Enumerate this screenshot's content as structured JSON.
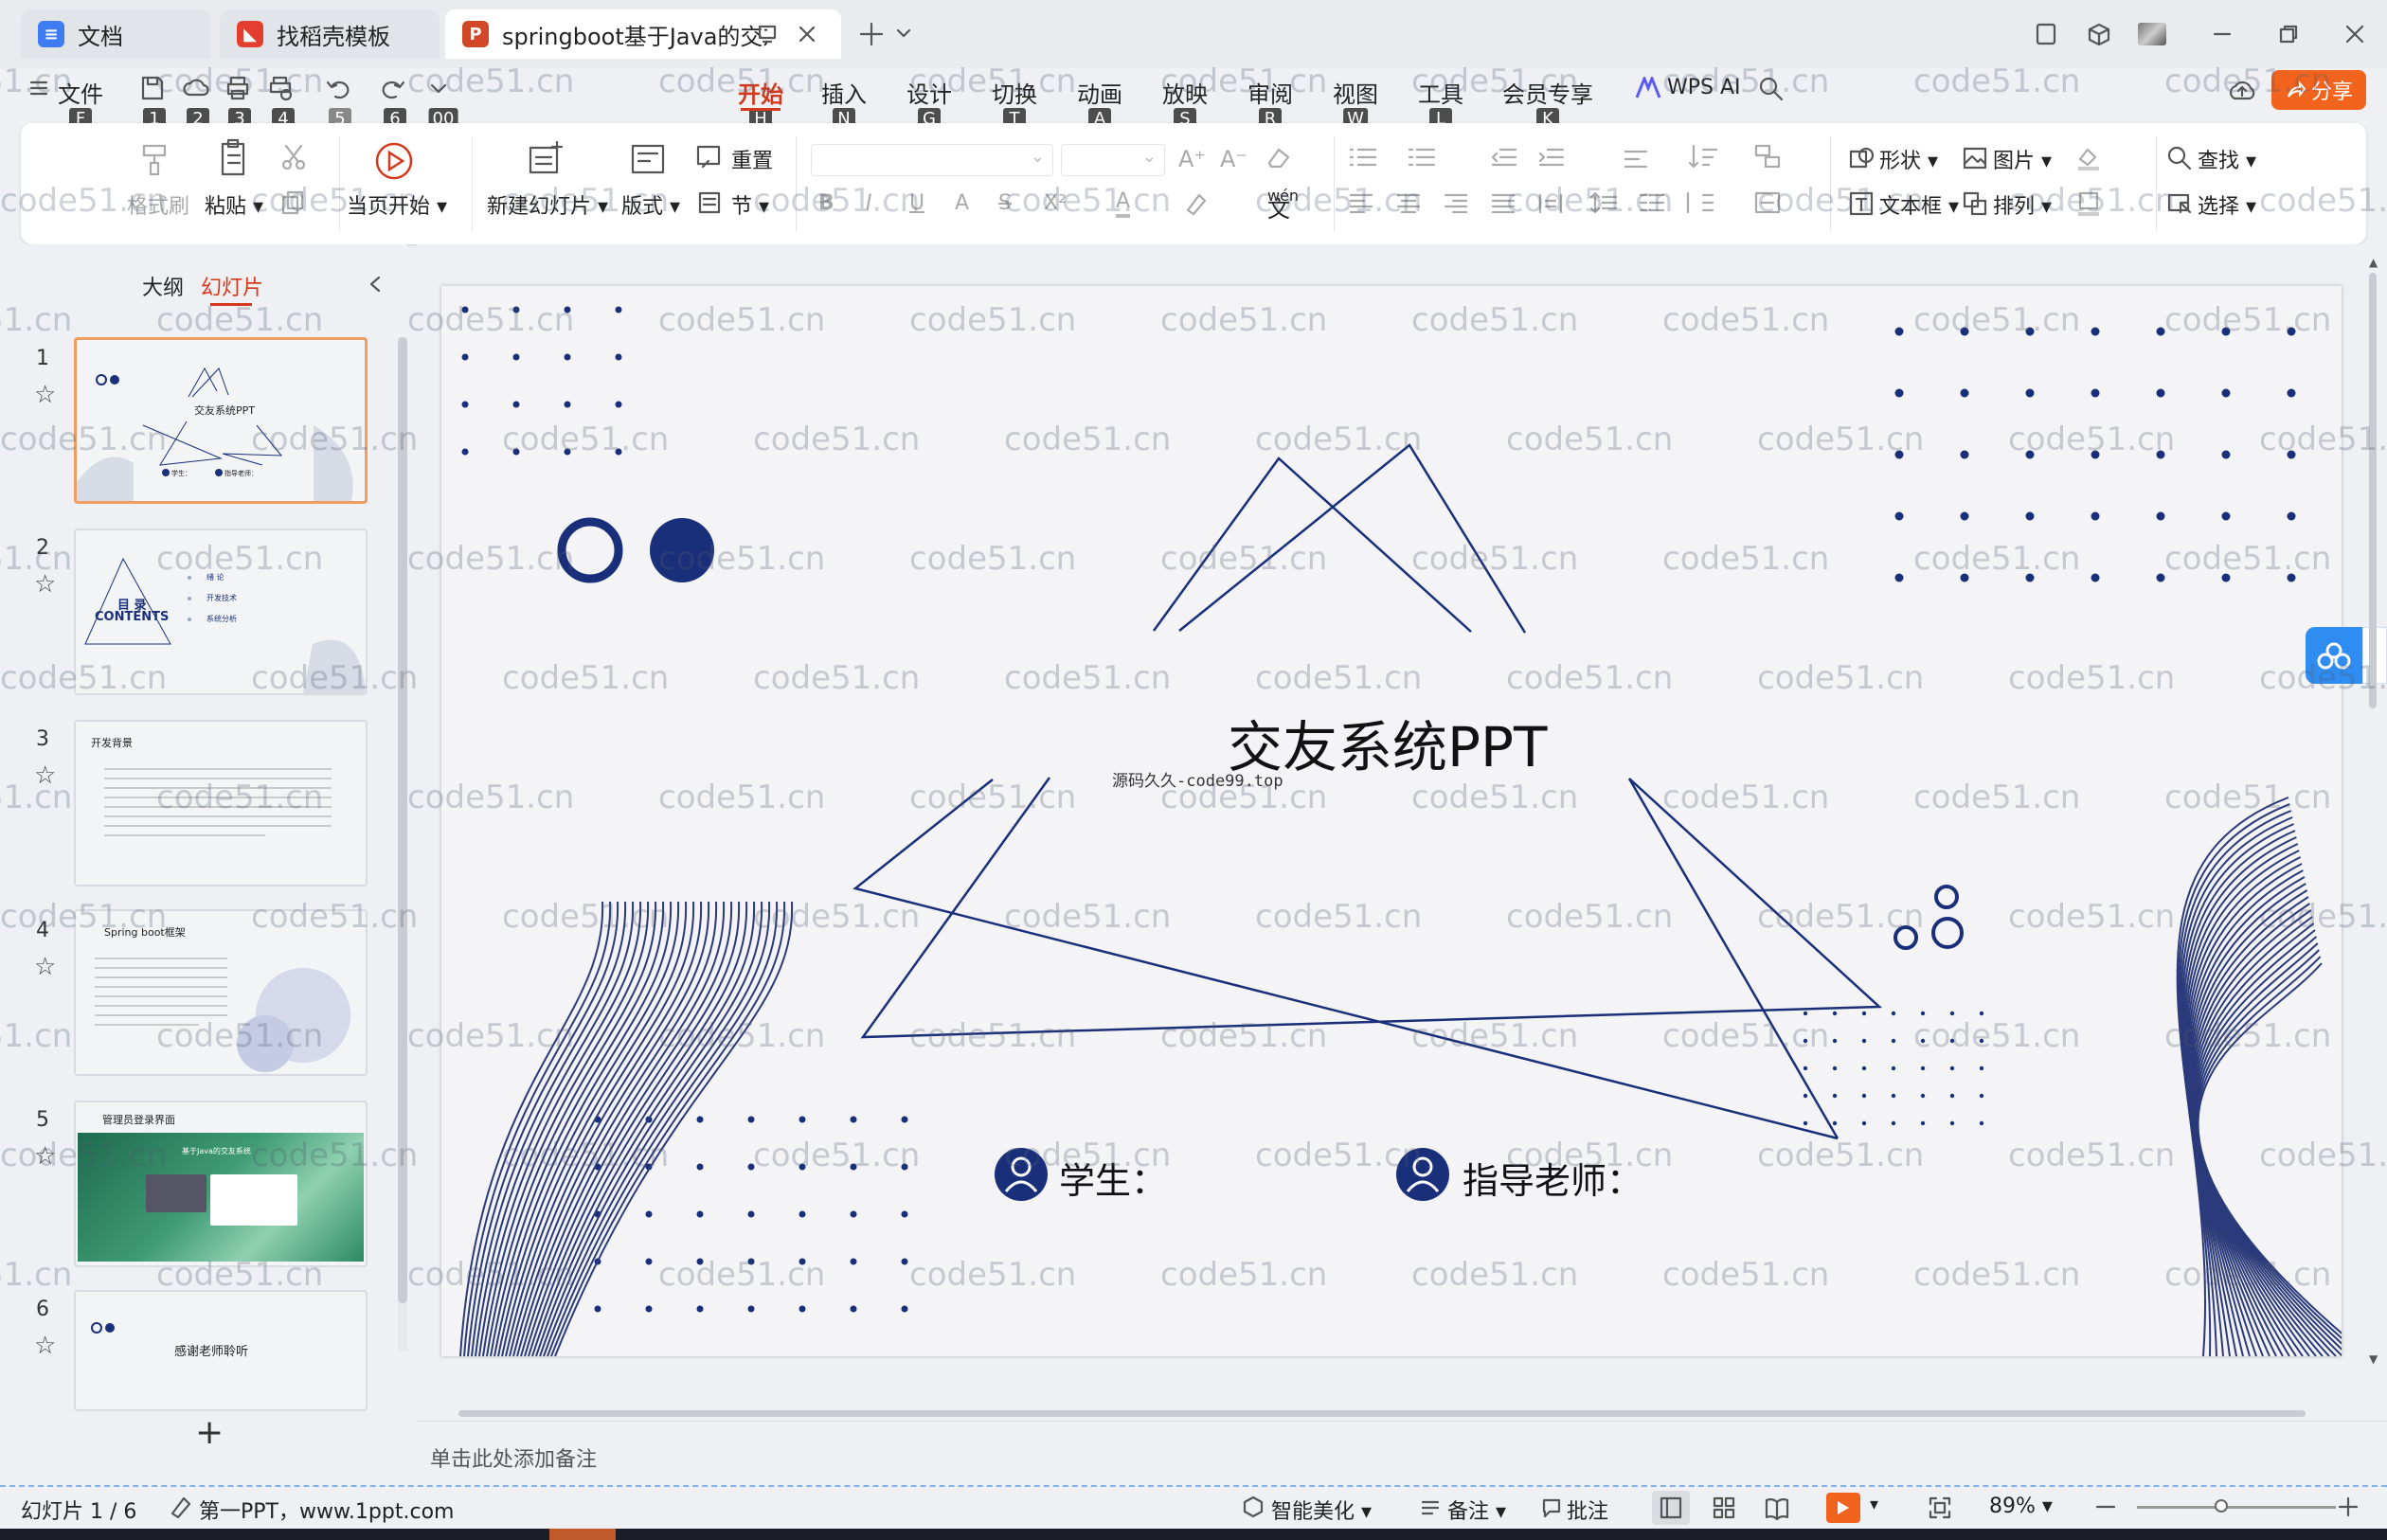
{
  "tabs": [
    {
      "label": "文档",
      "icon": "doc-icon",
      "color": "#3f7cf2"
    },
    {
      "label": "找稻壳模板",
      "icon": "docer-icon",
      "color": "#e33e2f"
    },
    {
      "label": "springboot基于Java的交友系",
      "icon": "ppt-icon",
      "color": "#d24726",
      "active": true
    }
  ],
  "menu": {
    "file": "文件",
    "file_key": "F",
    "quick_keys": [
      "1",
      "2",
      "3",
      "4",
      "5",
      "6",
      "00"
    ],
    "items": [
      {
        "label": "开始",
        "key": "H",
        "active": true
      },
      {
        "label": "插入",
        "key": "N"
      },
      {
        "label": "设计",
        "key": "G"
      },
      {
        "label": "切换",
        "key": "T"
      },
      {
        "label": "动画",
        "key": "A"
      },
      {
        "label": "放映",
        "key": "S"
      },
      {
        "label": "审阅",
        "key": "R"
      },
      {
        "label": "视图",
        "key": "W"
      },
      {
        "label": "工具",
        "key": "L"
      },
      {
        "label": "会员专享",
        "key": "K"
      }
    ],
    "wps_ai": "WPS AI",
    "share": "分享"
  },
  "ribbon": {
    "format_painter": "格式刷",
    "paste": "粘贴",
    "play_from_current": "当页开始",
    "new_slide": "新建幻灯片",
    "layout": "版式",
    "reset": "重置",
    "section": "节",
    "shape": "形状",
    "picture": "图片",
    "textbox": "文本框",
    "arrange": "排列",
    "find": "查找",
    "select": "选择"
  },
  "panel": {
    "outline_tab": "大纲",
    "slides_tab": "幻灯片"
  },
  "thumbnails": [
    {
      "num": "1",
      "title": "交友系统PPT",
      "student": "学生：",
      "teacher": "指导老师："
    },
    {
      "num": "2",
      "title_cn": "目 录",
      "title_en": "CONTENTS",
      "items": [
        "绪 论",
        "开发技术",
        "系统分析"
      ]
    },
    {
      "num": "3",
      "title": "开发背景"
    },
    {
      "num": "4",
      "title": "Spring boot框架"
    },
    {
      "num": "5",
      "title": "管理员登录界面",
      "screen_title": "基于Java的交友系统"
    },
    {
      "num": "6",
      "title": "感谢老师聆听"
    }
  ],
  "slide": {
    "title": "交友系统PPT",
    "subtitle": "源码久久-code99.top",
    "student_label": "学生：",
    "teacher_label": "指导老师：",
    "accent_color": "#1a2f7a"
  },
  "notes_placeholder": "单击此处添加备注",
  "status": {
    "slide_counter": "幻灯片 1 / 6",
    "theme": "第一PPT，www.1ppt.com",
    "beautify": "智能美化",
    "notes": "备注",
    "comment": "批注",
    "zoom": "89%"
  },
  "watermark": "code51.cn"
}
